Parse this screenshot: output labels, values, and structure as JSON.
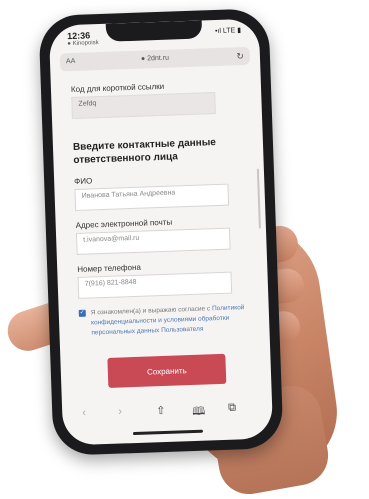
{
  "status": {
    "time": "12:36",
    "carrier": "● Kinopoisk",
    "signals": "•ıl LTE ▮"
  },
  "browser": {
    "aa_label": "AA",
    "domain": "● 2dnt.ru",
    "reload_icon": "reload-icon"
  },
  "form": {
    "code_label": "Код для короткой ссылки",
    "code_value": "Zefdq",
    "section_title": "Введите контактные данные ответственного лица",
    "fio_label": "ФИО",
    "fio_value": "Иванова Татьяна Андреевна",
    "email_label": "Адрес электронной почты",
    "email_value": "t.ivanova@mail.ru",
    "phone_label": "Номер телефона",
    "phone_value": "7(916) 821-8848",
    "consent_prefix": "Я ознакомлен(а) и выражаю согласие с",
    "consent_link": "Политикой конфиденциальности и условиями обработки персональных данных Пользователя",
    "save_label": "Сохранить"
  },
  "toolbar": {
    "back": "‹",
    "forward": "›",
    "share": "⇧",
    "bookmarks": "🕮",
    "tabs": "⧉"
  },
  "colors": {
    "accent": "#c94a55",
    "link": "#4a78b4",
    "skin": "#c98566"
  }
}
